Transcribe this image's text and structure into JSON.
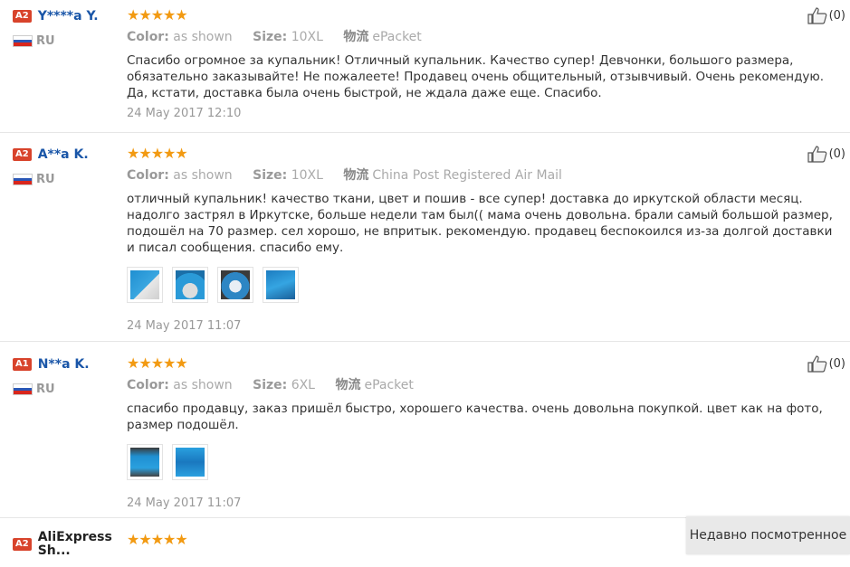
{
  "reviews": [
    {
      "level": "A2",
      "name": "Y****a Y.",
      "country": "RU",
      "rating": 5,
      "color_label": "Color:",
      "color": "as shown",
      "size_label": "Size:",
      "size": "10XL",
      "shipping_label": "物流",
      "shipping": "ePacket",
      "text": "Спасибо огромное за купальник! Отличный купальник. Качество супер! Девчонки, большого размера, обязательно заказывайте! Не пожалеете! Продавец очень общительный, отзывчивый. Очень рекомендую. Да, кстати, доставка была очень быстрой, не ждала даже еще. Спасибо.",
      "date": "24 May 2017 12:10",
      "helpful": "(0)",
      "photos": []
    },
    {
      "level": "A2",
      "name": "A**a K.",
      "country": "RU",
      "rating": 5,
      "color_label": "Color:",
      "color": "as shown",
      "size_label": "Size:",
      "size": "10XL",
      "shipping_label": "物流",
      "shipping": "China Post Registered Air Mail",
      "text": "отличный купальник! качество ткани, цвет и пошив - все супер! доставка до иркутской области месяц. надолго застрял в Иркутске, больше недели там был(( мама очень довольна. брали самый большой размер, подошёл на 70 размер. сел хорошо, не впритык. рекомендую. продавец беспокоился из-за долгой доставки и писал сообщения. спасибо ему.",
      "date": "24 May 2017 11:07",
      "helpful": "(0)",
      "photos": [
        "photo-1",
        "photo-2",
        "photo-3",
        "photo-4"
      ]
    },
    {
      "level": "A1",
      "name": "N**a K.",
      "country": "RU",
      "rating": 5,
      "color_label": "Color:",
      "color": "as shown",
      "size_label": "Size:",
      "size": "6XL",
      "shipping_label": "物流",
      "shipping": "ePacket",
      "text": "спасибо продавцу, заказ пришёл быстро, хорошего качества. очень довольна покупкой. цвет как на фото, размер подошёл.",
      "date": "24 May 2017 11:07",
      "helpful": "(0)",
      "photos": [
        "photo-1",
        "photo-2"
      ]
    },
    {
      "level": "A2",
      "name": "AliExpress Sh...",
      "rating": 5
    }
  ],
  "recently_viewed": "Недавно посмотренное",
  "colors": {
    "badge": "#d8432b",
    "username": "#1a56a8",
    "star": "#f29a12",
    "photo_blue": "#1f8fd1"
  },
  "icons": {
    "helpful": "thumbs-up-icon",
    "star": "star-icon",
    "flag": "russia-flag-icon"
  }
}
